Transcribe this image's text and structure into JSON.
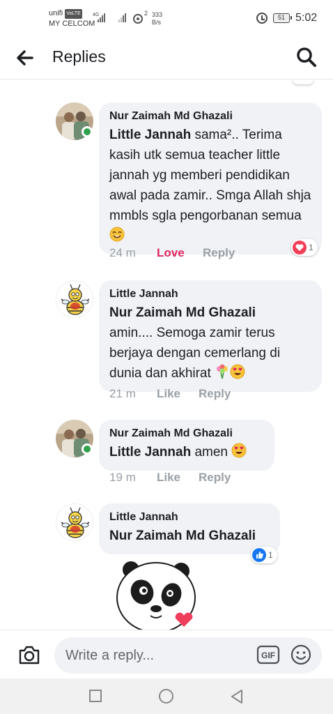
{
  "status_bar": {
    "carrier_1": "unifi",
    "volte_badge": "VoLTE",
    "carrier_2": "MY CELCOM",
    "network_type": "4G",
    "hotspot_count": "2",
    "speed_value": "333",
    "speed_unit": "B/s",
    "battery": "51",
    "time": "5:02"
  },
  "header": {
    "title": "Replies"
  },
  "comments": [
    {
      "author": "Nur Zaimah Md Ghazali",
      "mention": "Little Jannah",
      "text": " sama².. Terima kasih utk semua teacher little jannah yg memberi pendidikan awal pada zamir.. Smga Allah shja mmbls sgla pengorbanan semua",
      "time": "24 m",
      "reaction_label": "Love",
      "reply_label": "Reply",
      "reaction_count": "1"
    },
    {
      "author": "Little Jannah",
      "mention": "Nur Zaimah Md Ghazali",
      "text": "amin.... Semoga zamir terus berjaya dengan cemerlang di dunia dan akhirat",
      "time": "21 m",
      "reaction_label": "Like",
      "reply_label": "Reply"
    },
    {
      "author": "Nur Zaimah Md Ghazali",
      "mention": "Little Jannah",
      "text": " amen",
      "time": "19 m",
      "reaction_label": "Like",
      "reply_label": "Reply"
    },
    {
      "author": "Little Jannah",
      "mention": "Nur Zaimah Md Ghazali",
      "text": "",
      "reaction_count": "1"
    }
  ],
  "composer": {
    "placeholder": "Write a reply...",
    "gif_label": "GIF"
  },
  "icons": {
    "back": "arrow-left-icon",
    "search": "search-icon",
    "camera": "camera-icon",
    "gif": "gif-icon",
    "emoji": "smiley-icon"
  },
  "colors": {
    "love": "#e0245e",
    "like_blue": "#1877f2",
    "bubble": "#f0f2f5",
    "online": "#31a24c"
  }
}
